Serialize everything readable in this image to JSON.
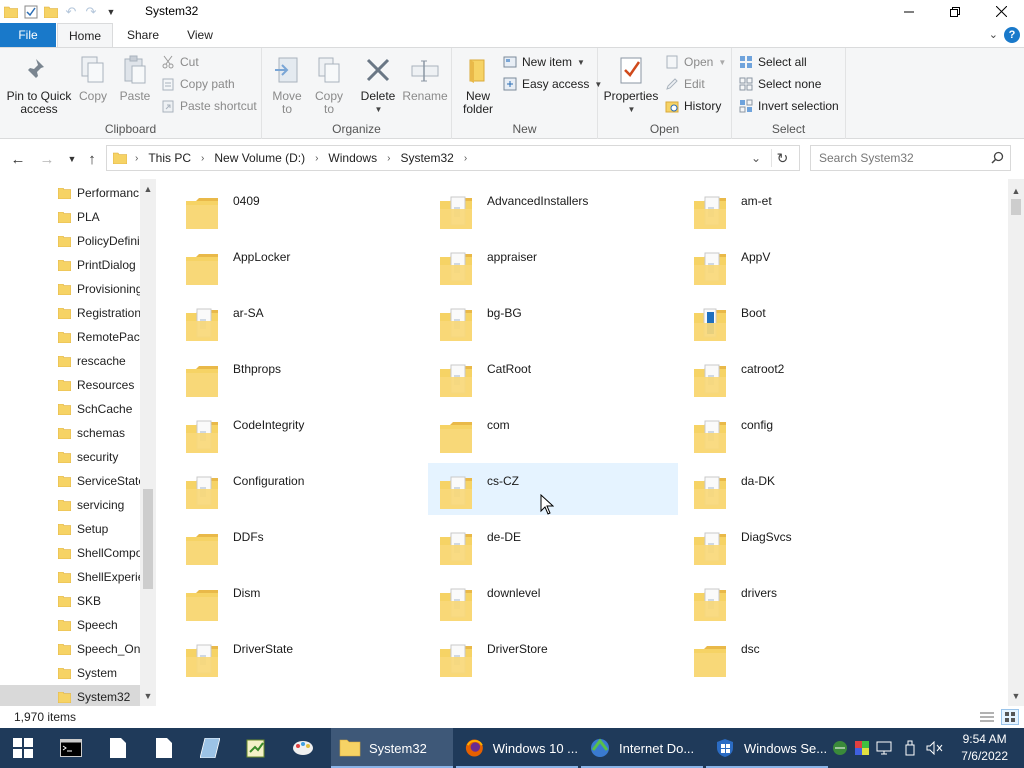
{
  "window": {
    "title": "System32",
    "controls": [
      "minimize",
      "maximize",
      "close"
    ]
  },
  "ribbon_tabs": {
    "file": "File",
    "home": "Home",
    "share": "Share",
    "view": "View",
    "active": "Home",
    "help": "?"
  },
  "ribbon": {
    "clipboard": {
      "label": "Clipboard",
      "pin_line1": "Pin to Quick",
      "pin_line2": "access",
      "copy": "Copy",
      "paste": "Paste",
      "cut": "Cut",
      "copy_path": "Copy path",
      "paste_shortcut": "Paste shortcut"
    },
    "organize": {
      "label": "Organize",
      "move_to_l1": "Move",
      "move_to_l2": "to",
      "copy_to_l1": "Copy",
      "copy_to_l2": "to",
      "delete": "Delete",
      "rename": "Rename"
    },
    "new": {
      "label": "New",
      "new_folder_l1": "New",
      "new_folder_l2": "folder",
      "new_item": "New item",
      "easy_access": "Easy access"
    },
    "open": {
      "label": "Open",
      "properties": "Properties",
      "open": "Open",
      "edit": "Edit",
      "history": "History"
    },
    "select": {
      "label": "Select",
      "select_all": "Select all",
      "select_none": "Select none",
      "invert": "Invert selection"
    }
  },
  "address": {
    "crumbs": [
      "This PC",
      "New Volume (D:)",
      "Windows",
      "System32"
    ],
    "search_placeholder": "Search System32"
  },
  "nav_pane": {
    "items": [
      "Performanc",
      "PLA",
      "PolicyDefini",
      "PrintDialog",
      "Provisioning",
      "Registration",
      "RemotePacl",
      "rescache",
      "Resources",
      "SchCache",
      "schemas",
      "security",
      "ServiceState",
      "servicing",
      "Setup",
      "ShellCompo",
      "ShellExperie",
      "SKB",
      "Speech",
      "Speech_One",
      "System",
      "System32"
    ],
    "selected": "System32"
  },
  "folders": {
    "items": [
      {
        "name": "0409",
        "type": "plain"
      },
      {
        "name": "AdvancedInstallers",
        "type": "doc"
      },
      {
        "name": "am-et",
        "type": "doc"
      },
      {
        "name": "AppLocker",
        "type": "plain"
      },
      {
        "name": "appraiser",
        "type": "doc"
      },
      {
        "name": "AppV",
        "type": "doc"
      },
      {
        "name": "ar-SA",
        "type": "doc"
      },
      {
        "name": "bg-BG",
        "type": "doc"
      },
      {
        "name": "Boot",
        "type": "blue"
      },
      {
        "name": "Bthprops",
        "type": "plain"
      },
      {
        "name": "CatRoot",
        "type": "doc"
      },
      {
        "name": "catroot2",
        "type": "doc"
      },
      {
        "name": "CodeIntegrity",
        "type": "doc"
      },
      {
        "name": "com",
        "type": "plain"
      },
      {
        "name": "config",
        "type": "doc"
      },
      {
        "name": "Configuration",
        "type": "doc"
      },
      {
        "name": "cs-CZ",
        "type": "doc"
      },
      {
        "name": "da-DK",
        "type": "doc"
      },
      {
        "name": "DDFs",
        "type": "plain"
      },
      {
        "name": "de-DE",
        "type": "doc"
      },
      {
        "name": "DiagSvcs",
        "type": "doc"
      },
      {
        "name": "Dism",
        "type": "plain"
      },
      {
        "name": "downlevel",
        "type": "doc"
      },
      {
        "name": "drivers",
        "type": "doc"
      },
      {
        "name": "DriverState",
        "type": "doc"
      },
      {
        "name": "DriverStore",
        "type": "doc"
      },
      {
        "name": "dsc",
        "type": "plain"
      }
    ],
    "hovered": "cs-CZ"
  },
  "status": {
    "item_count": "1,970 items"
  },
  "taskbar": {
    "apps": [
      {
        "label": "System32",
        "icon": "folder-icon",
        "active": true
      },
      {
        "label": "Windows 10 ...",
        "icon": "firefox-icon",
        "active": false
      },
      {
        "label": "Internet Do...",
        "icon": "idm-icon",
        "active": false
      },
      {
        "label": "Windows Se...",
        "icon": "windows-security-icon",
        "active": false
      }
    ],
    "time": "9:54 AM",
    "date": "7/6/2022"
  },
  "colors": {
    "accent": "#1979ca",
    "taskbar": "#1f3a5a",
    "folder": "#f6d365",
    "hover": "#e5f3ff"
  }
}
